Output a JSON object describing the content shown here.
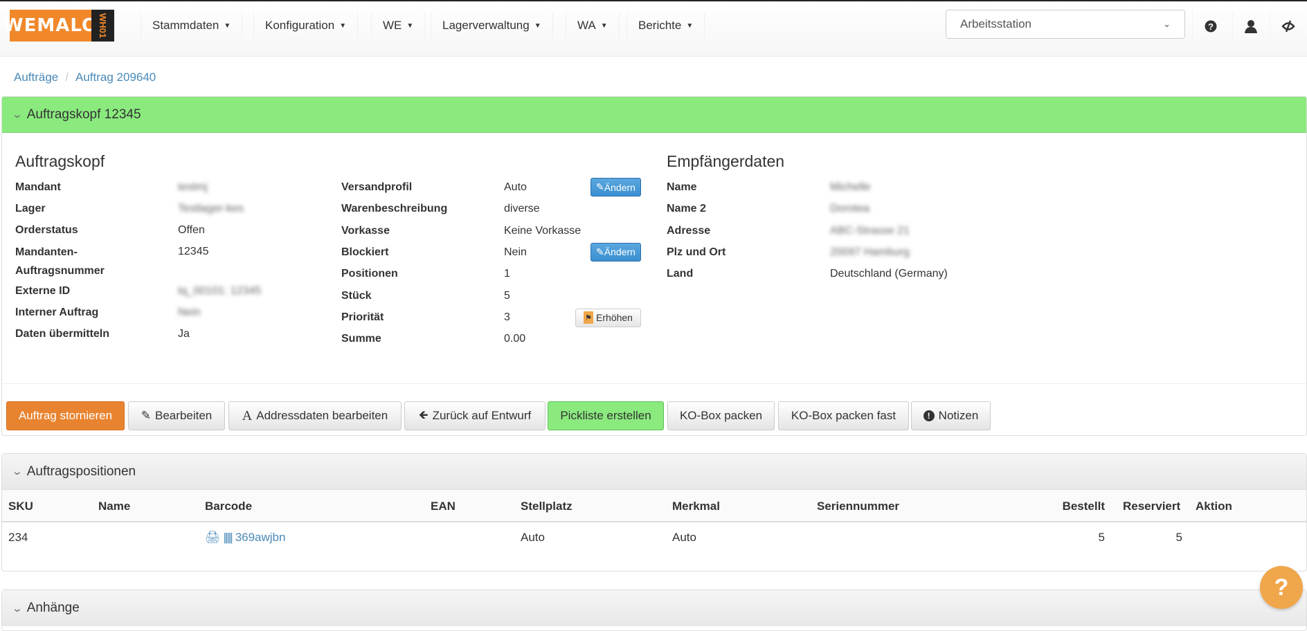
{
  "brand": {
    "logo_main": "WEMALO",
    "logo_sub": "WH01"
  },
  "nav": [
    "Stammdaten",
    "Konfiguration",
    "WE",
    "Lagerverwaltung",
    "WA",
    "Berichte"
  ],
  "workstation_select": {
    "value": "Arbeitsstation"
  },
  "breadcrumb": {
    "parent": "Aufträge",
    "current": "Auftrag 209640"
  },
  "header_panel": {
    "title": "Auftragskopf 12345"
  },
  "auftragskopf": {
    "heading": "Auftragskopf",
    "rows": [
      {
        "label": "Mandant",
        "value": "testmj"
      },
      {
        "label": "Lager",
        "value": "Testlager-kes"
      },
      {
        "label": "Orderstatus",
        "value": "Offen"
      },
      {
        "label": "Mandanten-Auftragsnummer",
        "value": "12345"
      },
      {
        "label": "Externe ID",
        "value": "tq_00101: 12345"
      },
      {
        "label": "Interner Auftrag",
        "value": "Nein"
      },
      {
        "label": "Daten übermitteln",
        "value": "Ja"
      }
    ]
  },
  "details": [
    {
      "label": "Versandprofil",
      "value": "Auto",
      "button": "Ändern"
    },
    {
      "label": "Warenbeschreibung",
      "value": "diverse"
    },
    {
      "label": "Vorkasse",
      "value": "Keine Vorkasse"
    },
    {
      "label": "Blockiert",
      "value": "Nein",
      "button": "Ändern"
    },
    {
      "label": "Positionen",
      "value": "1"
    },
    {
      "label": "Stück",
      "value": "5"
    },
    {
      "label": "Priorität",
      "value": "3",
      "button": "Erhöhen"
    },
    {
      "label": "Summe",
      "value": "0.00"
    }
  ],
  "empfaenger": {
    "heading": "Empfängerdaten",
    "rows": [
      {
        "label": "Name",
        "value": "Michelle"
      },
      {
        "label": "Name 2",
        "value": "Dorotea"
      },
      {
        "label": "Adresse",
        "value": "ABC-Strasse 21"
      },
      {
        "label": "Plz und Ort",
        "value": "20097 Hamburg"
      },
      {
        "label": "Land",
        "value": "Deutschland (Germany)"
      }
    ]
  },
  "actions": [
    "Auftrag stornieren",
    "Bearbeiten",
    "Addressdaten bearbeiten",
    "Zurück auf Entwurf",
    "Pickliste erstellen",
    "KO-Box packen",
    "KO-Box packen fast",
    "Notizen"
  ],
  "positions_panel": {
    "title": "Auftragspositionen",
    "columns": [
      "SKU",
      "Name",
      "Barcode",
      "EAN",
      "Stellplatz",
      "Merkmal",
      "Seriennummer",
      "Bestellt",
      "Reserviert",
      "Aktion"
    ],
    "rows": [
      {
        "sku": "234",
        "name": "",
        "barcode": "369awjbn",
        "ean": "",
        "stellplatz": "Auto",
        "merkmal": "Auto",
        "seriennummer": "",
        "bestellt": "5",
        "reserviert": "5"
      }
    ]
  },
  "attachments_panel": {
    "title": "Anhänge"
  },
  "help_fab": "?",
  "colors": {
    "accent_orange": "#e8832f",
    "success_green": "#8aea7e",
    "link_blue": "#4a8ab8"
  }
}
